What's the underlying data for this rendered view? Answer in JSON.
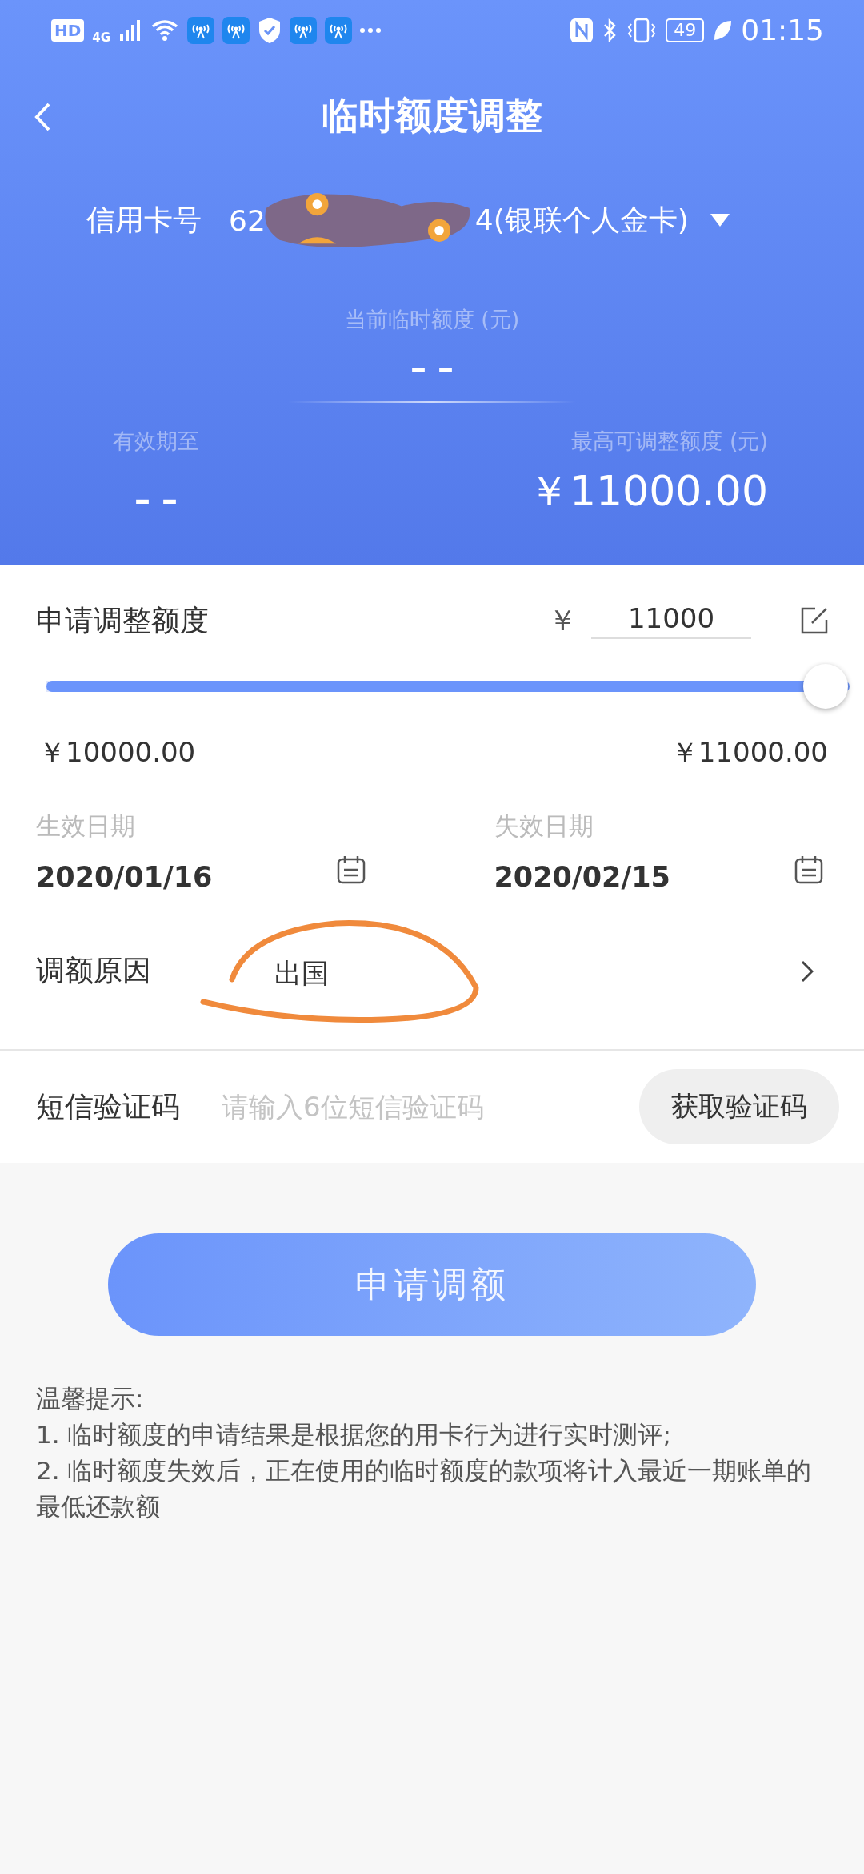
{
  "status_bar": {
    "hd": "HD",
    "network": "4G",
    "battery": "49",
    "time": "01:15"
  },
  "header": {
    "title": "临时额度调整",
    "card_label": "信用卡号",
    "card_number_start": "62",
    "card_number_end": "4(银联个人金卡)",
    "current_label": "当前临时额度 (元)",
    "current_value": "– –",
    "valid_label": "有效期至",
    "valid_value": "– –",
    "max_label": "最高可调整额度 (元)",
    "max_value": "￥11000.00"
  },
  "amount": {
    "label": "申请调整额度",
    "currency": "￥",
    "value": "11000",
    "level": 1,
    "min": "￥10000.00",
    "max": "￥11000.00"
  },
  "dates": [
    {
      "label": "生效日期",
      "value": "2020/01/16"
    },
    {
      "label": "失效日期",
      "value": "2020/02/15"
    }
  ],
  "reason": {
    "label": "调额原因",
    "value": "出国",
    "circled": true
  },
  "sms": {
    "label": "短信验证码",
    "placeholder": "请输入6位短信验证码",
    "button": "获取验证码"
  },
  "submit": "申请调额",
  "tips": [
    "温馨提示:",
    "1. 临时额度的申请结果是根据您的用卡行为进行实时测评;",
    "2. 临时额度失效后，正在使用的临时额度的款项将计入最近一期账单的最低还款额"
  ]
}
